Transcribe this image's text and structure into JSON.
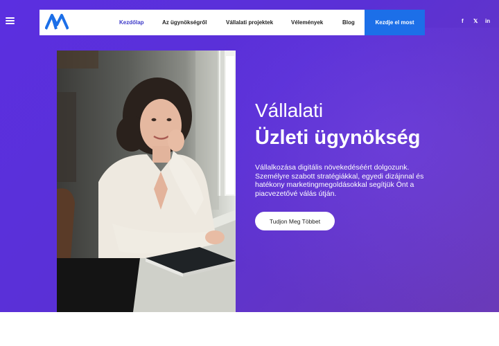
{
  "colors": {
    "brand": "#1c6fe8",
    "nav_active": "#3c39c8",
    "hero_bg": "#5b2fe0"
  },
  "header": {
    "menu_icon": "hamburger-menu-icon",
    "logo_icon": "agency-logo-icon",
    "nav": [
      {
        "label": "Kezdőlap",
        "active": true
      },
      {
        "label": "Az ügynökségről",
        "active": false
      },
      {
        "label": "Vállalati projektek",
        "active": false
      },
      {
        "label": "Vélemények",
        "active": false
      },
      {
        "label": "Blog",
        "active": false
      }
    ],
    "cta_label": "Kezdje el most"
  },
  "socials": [
    {
      "icon": "facebook-icon",
      "glyph": "f"
    },
    {
      "icon": "x-twitter-icon",
      "glyph": "𝕏"
    },
    {
      "icon": "linkedin-icon",
      "glyph": "in"
    }
  ],
  "hero": {
    "photo": "woman-by-window-photo",
    "subtitle": "Vállalati",
    "title": "Üzleti ügynökség",
    "description": "Vállalkozása digitális növekedéséért dolgozunk. Személyre szabott stratégiákkal, egyedi dizájnnal és hatékony marketingmegoldásokkal segítjük Önt a piacvezetővé válás útján.",
    "cta_label": "Tudjon Meg Többet"
  }
}
